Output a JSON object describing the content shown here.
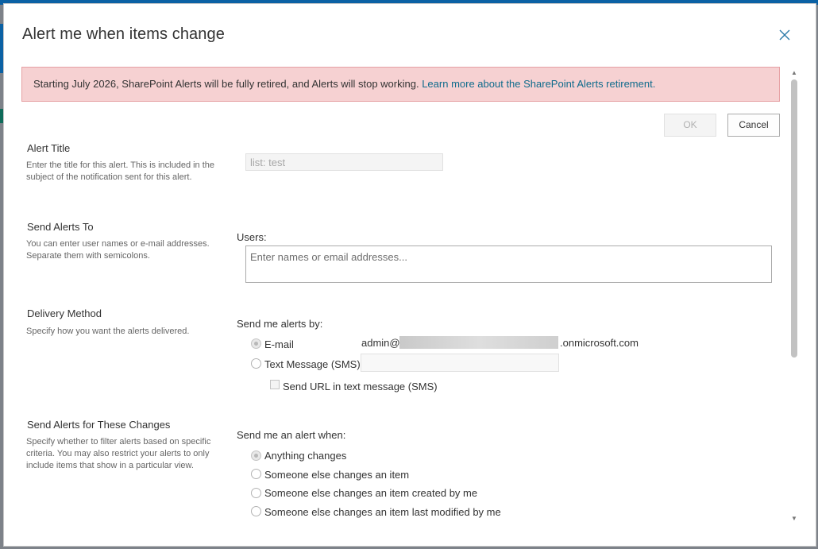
{
  "dialog": {
    "title": "Alert me when items change",
    "close_icon": "close-icon"
  },
  "banner": {
    "text": "Starting July 2026, SharePoint Alerts will be fully retired, and Alerts will stop working.",
    "link": "Learn more about the SharePoint Alerts retirement."
  },
  "buttons": {
    "ok": "OK",
    "cancel": "Cancel"
  },
  "alert_title": {
    "heading": "Alert Title",
    "description": "Enter the title for this alert. This is included in the subject of the notification sent for this alert.",
    "value": "list: test"
  },
  "send_to": {
    "heading": "Send Alerts To",
    "description": "You can enter user names or e-mail addresses. Separate them with semicolons.",
    "users_label": "Users:",
    "users_placeholder": "Enter names or email addresses..."
  },
  "delivery": {
    "heading": "Delivery Method",
    "description": "Specify how you want the alerts delivered.",
    "send_by_label": "Send me alerts by:",
    "email_label": "E-mail",
    "email_prefix": "admin@",
    "email_suffix": ".onmicrosoft.com",
    "sms_label": "Text Message (SMS)",
    "sms_url_label": "Send URL in text message (SMS)"
  },
  "changes": {
    "heading": "Send Alerts for These Changes",
    "description": "Specify whether to filter alerts based on specific criteria. You may also restrict your alerts to only include items that show in a particular view.",
    "when_label": "Send me an alert when:",
    "options": [
      "Anything changes",
      "Someone else changes an item",
      "Someone else changes an item created by me",
      "Someone else changes an item last modified by me"
    ]
  },
  "colors": {
    "banner_bg": "#f6d1d2",
    "link": "#0f6b8c",
    "brand": "#0b61a4"
  }
}
